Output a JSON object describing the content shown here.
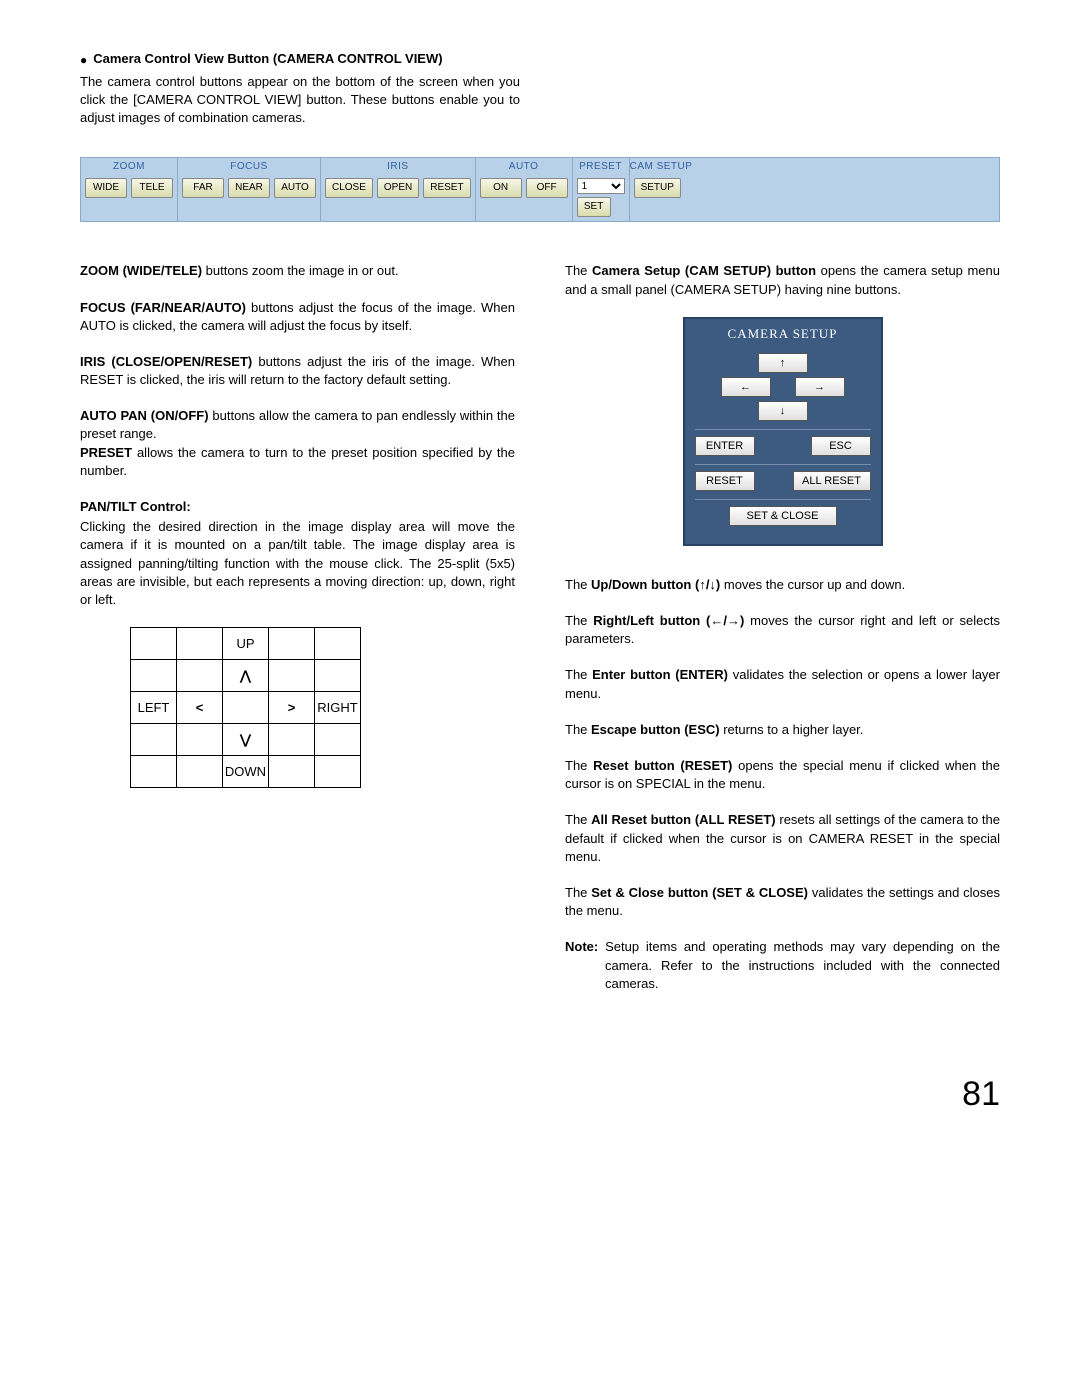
{
  "heading": "Camera Control View Button (CAMERA CONTROL VIEW)",
  "intro": "The camera control buttons appear on the bottom of the screen when you click the [CAMERA CONTROL VIEW] button. These buttons enable you to adjust images of combination cameras.",
  "bar": {
    "zoom": {
      "header": "ZOOM",
      "wide": "WIDE",
      "tele": "TELE"
    },
    "focus": {
      "header": "FOCUS",
      "far": "FAR",
      "near": "NEAR",
      "auto": "AUTO"
    },
    "iris": {
      "header": "IRIS",
      "close": "CLOSE",
      "open": "OPEN",
      "reset": "RESET"
    },
    "autopan": {
      "header": "AUTO",
      "on": "ON",
      "off": "OFF"
    },
    "preset": {
      "header": "PRESET",
      "value": "1",
      "set": "SET"
    },
    "camsetup": {
      "header": "CAM SETUP",
      "setup": "SETUP"
    }
  },
  "left": {
    "zoom": {
      "label": "ZOOM (WIDE/TELE)",
      "text": " buttons zoom the image in or out."
    },
    "focus": {
      "label": "FOCUS (FAR/NEAR/AUTO)",
      "text": " buttons adjust the focus of the image. When AUTO is clicked, the camera will adjust the focus by itself."
    },
    "iris": {
      "label": "IRIS (CLOSE/OPEN/RESET)",
      "text": " buttons adjust the iris of the image. When RESET is clicked, the iris will return to the factory default setting."
    },
    "autopan": {
      "label": "AUTO PAN (ON/OFF)",
      "text": " buttons allow the camera to pan endlessly within the preset range."
    },
    "preset": {
      "label": "PRESET",
      "text": " allows the camera to turn to the preset position specified by the number."
    },
    "pantilt_head": "PAN/TILT Control:",
    "pantilt_text": "Clicking the desired direction in the image display area will move the camera if it is mounted on a pan/tilt table. The image display area is assigned panning/tilting function with the mouse click. The 25-split (5x5) areas are invisible, but each represents a moving direction: up, down, right or left.",
    "grid": {
      "up": "UP",
      "down": "DOWN",
      "left": "LEFT",
      "right": "RIGHT"
    }
  },
  "right": {
    "camsetup_intro_label": "Camera Setup (CAM SETUP) button",
    "camsetup_intro_pre": "The ",
    "camsetup_intro_post": " opens the camera setup menu and a small panel (CAMERA SETUP) having nine buttons.",
    "panel": {
      "title": "CAMERA SETUP",
      "up": "↑",
      "down": "↓",
      "left": "←",
      "right": "→",
      "enter": "ENTER",
      "esc": "ESC",
      "reset": "RESET",
      "allreset": "ALL RESET",
      "setclose": "SET & CLOSE"
    },
    "updown": {
      "label": "Up/Down button (↑/↓)",
      "pre": "The ",
      "post": " moves the cursor up and down."
    },
    "rightleft": {
      "label": "Right/Left button (←/→)",
      "pre": "The ",
      "post": " moves the cursor right and left or selects parameters."
    },
    "enter": {
      "label": "Enter button (ENTER)",
      "pre": "The ",
      "post": " validates the selection or opens a lower layer menu."
    },
    "escape": {
      "label": "Escape button (ESC)",
      "pre": "The ",
      "post": " returns to a higher layer."
    },
    "reset": {
      "label": "Reset button (RESET)",
      "pre": "The ",
      "post": " opens the special menu if clicked when the cursor is on SPECIAL in the menu."
    },
    "allreset": {
      "label": "All Reset button (ALL RESET)",
      "pre": "The ",
      "post": " resets all settings of the camera to the default if clicked when the cursor is on CAMERA RESET in the special menu."
    },
    "setclose": {
      "label": "Set & Close button (SET & CLOSE)",
      "pre": "The ",
      "post": " validates the settings and closes the menu."
    },
    "note_label": "Note:",
    "note_text": " Setup items and operating methods may vary depending on the camera. Refer to the instructions included with the connected cameras."
  },
  "page_number": "81"
}
